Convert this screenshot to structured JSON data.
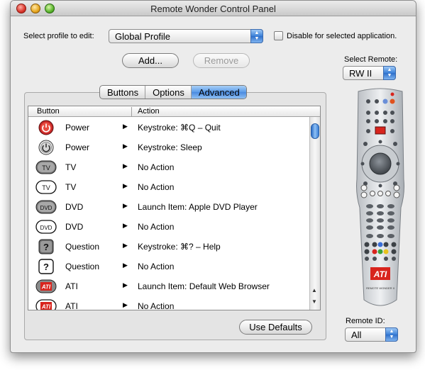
{
  "window": {
    "title": "Remote Wonder Control Panel"
  },
  "profile": {
    "label": "Select profile to edit:",
    "value": "Global Profile",
    "disable_label": "Disable for selected application."
  },
  "buttons": {
    "add": "Add...",
    "remove": "Remove",
    "use_defaults": "Use Defaults"
  },
  "select_remote": {
    "label": "Select Remote:",
    "value": "RW II"
  },
  "remote_id": {
    "label": "Remote ID:",
    "value": "All"
  },
  "tabs": [
    "Buttons",
    "Options",
    "Advanced"
  ],
  "active_tab": "Advanced",
  "table": {
    "columns": [
      "Button",
      "Action"
    ],
    "rows": [
      {
        "icon": "power-red-icon",
        "name": "Power",
        "action": "Keystroke: ⌘Q  –  Quit"
      },
      {
        "icon": "power-white-icon",
        "name": "Power",
        "action": "Keystroke:   Sleep"
      },
      {
        "icon": "tv-filled-icon",
        "name": "TV",
        "action": "No Action"
      },
      {
        "icon": "tv-outline-icon",
        "name": "TV",
        "action": "No Action"
      },
      {
        "icon": "dvd-filled-icon",
        "name": "DVD",
        "action": "Launch Item: Apple DVD Player"
      },
      {
        "icon": "dvd-outline-icon",
        "name": "DVD",
        "action": "No Action"
      },
      {
        "icon": "question-filled-icon",
        "name": "Question",
        "action": "Keystroke: ⌘?  –  Help"
      },
      {
        "icon": "question-outline-icon",
        "name": "Question",
        "action": "No Action"
      },
      {
        "icon": "ati-filled-icon",
        "name": "ATI",
        "action": "Launch Item: Default Web Browser"
      },
      {
        "icon": "ati-outline-icon",
        "name": "ATI",
        "action": "No Action"
      }
    ]
  },
  "remote_image": {
    "logo_text": "ATI",
    "model_text": "REMOTE WONDER II"
  },
  "colors": {
    "accent": "#4a8ae0",
    "window_bg": "#ececec"
  }
}
